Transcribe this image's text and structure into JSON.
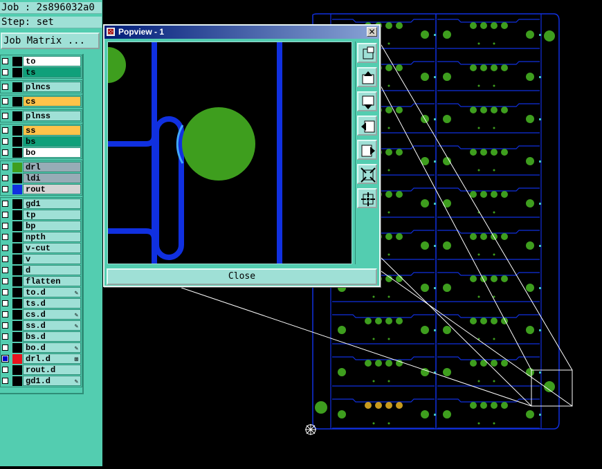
{
  "job_label": "Job : 2s896032a0",
  "step_label": "Step: set",
  "job_matrix_button": "Job Matrix ...",
  "layers": [
    {
      "name": "to",
      "color": "#ffffff",
      "swatch": "#000000",
      "checked": false,
      "mark": ""
    },
    {
      "name": "ts",
      "color": "#10a07a",
      "swatch": "#000000",
      "checked": false,
      "mark": ""
    },
    {
      "name": "plncs",
      "color": "#9fe0d6",
      "swatch": "#000000",
      "checked": false,
      "mark": ""
    },
    {
      "name": "cs",
      "color": "#ffc34a",
      "swatch": "#000000",
      "checked": false,
      "mark": ""
    },
    {
      "name": "plnss",
      "color": "#9fe0d6",
      "swatch": "#000000",
      "checked": false,
      "mark": ""
    },
    {
      "name": "ss",
      "color": "#ffc34a",
      "swatch": "#000000",
      "checked": false,
      "mark": ""
    },
    {
      "name": "bs",
      "color": "#10a07a",
      "swatch": "#000000",
      "checked": false,
      "mark": ""
    },
    {
      "name": "bo",
      "color": "#ffffff",
      "swatch": "#000000",
      "checked": false,
      "mark": ""
    },
    {
      "name": "drl",
      "color": "#97acb6",
      "swatch": "#3e9e1e",
      "checked": false,
      "mark": ""
    },
    {
      "name": "ldi",
      "color": "#97acb6",
      "swatch": "#000000",
      "checked": false,
      "mark": ""
    },
    {
      "name": "rout",
      "color": "#d4d4d4",
      "swatch": "#1030e0",
      "checked": false,
      "mark": ""
    },
    {
      "name": "gd1",
      "color": "#9fe0d6",
      "swatch": "#000000",
      "checked": false,
      "mark": ""
    },
    {
      "name": "tp",
      "color": "#9fe0d6",
      "swatch": "#000000",
      "checked": false,
      "mark": ""
    },
    {
      "name": "bp",
      "color": "#9fe0d6",
      "swatch": "#000000",
      "checked": false,
      "mark": ""
    },
    {
      "name": "npth",
      "color": "#9fe0d6",
      "swatch": "#000000",
      "checked": false,
      "mark": ""
    },
    {
      "name": "v-cut",
      "color": "#9fe0d6",
      "swatch": "#000000",
      "checked": false,
      "mark": ""
    },
    {
      "name": "v",
      "color": "#9fe0d6",
      "swatch": "#000000",
      "checked": false,
      "mark": ""
    },
    {
      "name": "d",
      "color": "#9fe0d6",
      "swatch": "#000000",
      "checked": false,
      "mark": ""
    },
    {
      "name": "flatten",
      "color": "#9fe0d6",
      "swatch": "#000000",
      "checked": false,
      "mark": ""
    },
    {
      "name": "to.d",
      "color": "#9fe0d6",
      "swatch": "#000000",
      "checked": false,
      "mark": "✎"
    },
    {
      "name": "ts.d",
      "color": "#9fe0d6",
      "swatch": "#000000",
      "checked": false,
      "mark": ""
    },
    {
      "name": "cs.d",
      "color": "#9fe0d6",
      "swatch": "#000000",
      "checked": false,
      "mark": "✎"
    },
    {
      "name": "ss.d",
      "color": "#9fe0d6",
      "swatch": "#000000",
      "checked": false,
      "mark": "✎"
    },
    {
      "name": "bs.d",
      "color": "#9fe0d6",
      "swatch": "#000000",
      "checked": false,
      "mark": ""
    },
    {
      "name": "bo.d",
      "color": "#9fe0d6",
      "swatch": "#000000",
      "checked": false,
      "mark": "✎"
    },
    {
      "name": "drl.d",
      "color": "#9fe0d6",
      "swatch": "#e8141e",
      "checked": true,
      "mark": "⊞"
    },
    {
      "name": "rout.d",
      "color": "#9fe0d6",
      "swatch": "#000000",
      "checked": false,
      "mark": ""
    },
    {
      "name": "gd1.d",
      "color": "#9fe0d6",
      "swatch": "#000000",
      "checked": false,
      "mark": "✎"
    }
  ],
  "popview": {
    "title": "Popview - 1",
    "close_label": "Close",
    "tools": [
      "zoom-window-icon",
      "pan-up-icon",
      "pan-down-icon",
      "pan-left-icon",
      "pan-right-icon",
      "zoom-out-icon",
      "zoom-in-icon"
    ]
  },
  "colors": {
    "panel": "#53cdb0",
    "panel_light": "#9fe0d6",
    "rout_blue": "#1030e0",
    "pad_green": "#3e9e1e",
    "pad_gold": "#c89a1e",
    "canvas": "#000000"
  }
}
